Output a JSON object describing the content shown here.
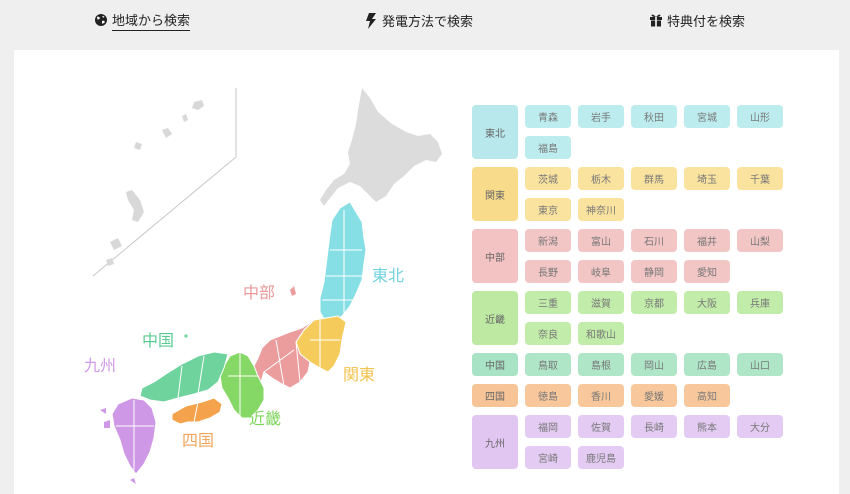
{
  "nav": {
    "tabs": [
      {
        "label": "地域から検索",
        "icon": "globe-icon",
        "active": true
      },
      {
        "label": "発電方法で検索",
        "icon": "lightning-icon",
        "active": false
      },
      {
        "label": "特典付を検索",
        "icon": "gift-icon",
        "active": false
      }
    ]
  },
  "map": {
    "labels": {
      "tohoku": "東北",
      "chubu": "中部",
      "kanto": "関東",
      "chugoku": "中国",
      "kinki": "近畿",
      "shikoku": "四国",
      "kyushu": "九州"
    }
  },
  "regions": [
    {
      "name": "東北",
      "head_color": "#b8e8ec",
      "pref_color": "#bdecef",
      "label_color": "#6fd3dc",
      "prefs": [
        "青森",
        "岩手",
        "秋田",
        "宮城",
        "山形",
        "福島"
      ]
    },
    {
      "name": "関東",
      "head_color": "#f8dc8c",
      "pref_color": "#fae39f",
      "label_color": "#f2c24e",
      "prefs": [
        "茨城",
        "栃木",
        "群馬",
        "埼玉",
        "千葉",
        "東京",
        "神奈川"
      ]
    },
    {
      "name": "中部",
      "head_color": "#f3c2c2",
      "pref_color": "#f3c6c6",
      "label_color": "#e9999a",
      "prefs": [
        "新潟",
        "富山",
        "石川",
        "福井",
        "山梨",
        "長野",
        "岐阜",
        "静岡",
        "愛知"
      ]
    },
    {
      "name": "近畿",
      "head_color": "#bde9a3",
      "pref_color": "#c2eca9",
      "label_color": "#7fd55c",
      "prefs": [
        "三重",
        "滋賀",
        "京都",
        "大阪",
        "兵庫",
        "奈良",
        "和歌山"
      ]
    },
    {
      "name": "中国",
      "head_color": "#a9e3c5",
      "pref_color": "#b0e6c8",
      "label_color": "#5ccb93",
      "prefs": [
        "鳥取",
        "島根",
        "岡山",
        "広島",
        "山口"
      ]
    },
    {
      "name": "四国",
      "head_color": "#f7c497",
      "pref_color": "#f8c89c",
      "label_color": "#f1a55a",
      "prefs": [
        "徳島",
        "香川",
        "愛媛",
        "高知"
      ]
    },
    {
      "name": "九州",
      "head_color": "#e2c6f2",
      "pref_color": "#e4cbf3",
      "label_color": "#cf9ae6",
      "prefs": [
        "福岡",
        "佐賀",
        "長崎",
        "熊本",
        "大分",
        "宮崎",
        "鹿児島"
      ]
    }
  ]
}
